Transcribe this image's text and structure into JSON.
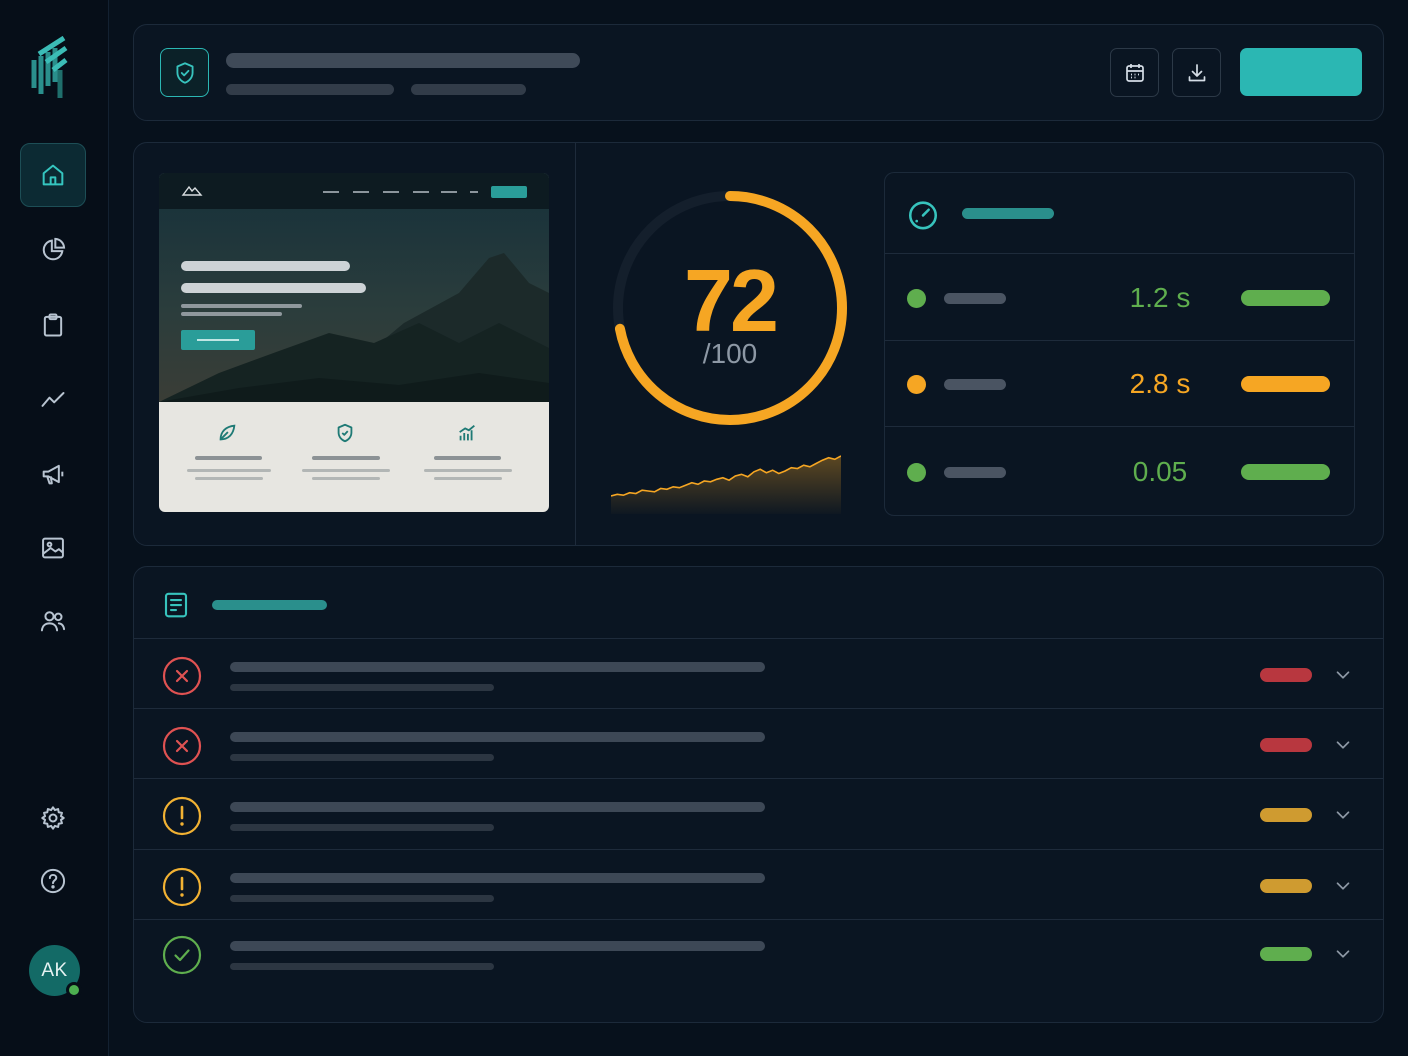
{
  "user": {
    "initials": "AK",
    "status": "online"
  },
  "sidebar": {
    "items": [
      {
        "name": "home",
        "icon": "home-icon",
        "active": true
      },
      {
        "name": "analytics",
        "icon": "pie-chart-icon"
      },
      {
        "name": "reports",
        "icon": "clipboard-icon"
      },
      {
        "name": "trends",
        "icon": "trend-line-icon"
      },
      {
        "name": "campaigns",
        "icon": "megaphone-icon"
      },
      {
        "name": "media",
        "icon": "image-icon"
      },
      {
        "name": "team",
        "icon": "users-icon"
      }
    ],
    "bottom": [
      {
        "name": "settings",
        "icon": "gear-icon"
      },
      {
        "name": "help",
        "icon": "help-circle-icon"
      }
    ]
  },
  "header": {
    "icon": "shield-check-icon",
    "actions": [
      {
        "name": "date-range",
        "icon": "calendar-icon"
      },
      {
        "name": "export",
        "icon": "download-icon"
      }
    ]
  },
  "score": {
    "value": "72",
    "max": "/100",
    "fraction": 0.72,
    "color": "#f6a623",
    "trend": [
      9,
      11,
      10,
      13,
      12,
      16,
      15,
      14,
      18,
      17,
      20,
      19,
      22,
      25,
      23,
      27,
      26,
      29,
      31,
      28,
      33,
      35,
      32,
      38,
      41,
      37,
      40,
      36,
      39,
      43,
      42,
      46,
      44,
      48,
      52,
      55,
      53,
      57
    ]
  },
  "metrics": {
    "icon": "gauge-icon",
    "rows": [
      {
        "value": "1.2 s",
        "status": "good",
        "color": "#5fae4e"
      },
      {
        "value": "2.8 s",
        "status": "warning",
        "color": "#f6a623"
      },
      {
        "value": "0.05",
        "status": "good",
        "color": "#5fae4e"
      }
    ]
  },
  "issues": {
    "icon": "document-list-icon",
    "rows": [
      {
        "status": "error",
        "icon": "x-circle-icon",
        "color": "#e05252",
        "badge_color": "#b8373f"
      },
      {
        "status": "error",
        "icon": "x-circle-icon",
        "color": "#e05252",
        "badge_color": "#b8373f"
      },
      {
        "status": "warning",
        "icon": "alert-circle-icon",
        "color": "#f2b233",
        "badge_color": "#cf9b30"
      },
      {
        "status": "warning",
        "icon": "alert-circle-icon",
        "color": "#f2b233",
        "badge_color": "#cf9b30"
      },
      {
        "status": "passed",
        "icon": "check-circle-icon",
        "color": "#5fae4e",
        "badge_color": "#5fae4e"
      }
    ]
  },
  "colors": {
    "accent": "#2bb7b3",
    "warning": "#f6a623",
    "success": "#5fae4e",
    "error": "#e05252"
  }
}
